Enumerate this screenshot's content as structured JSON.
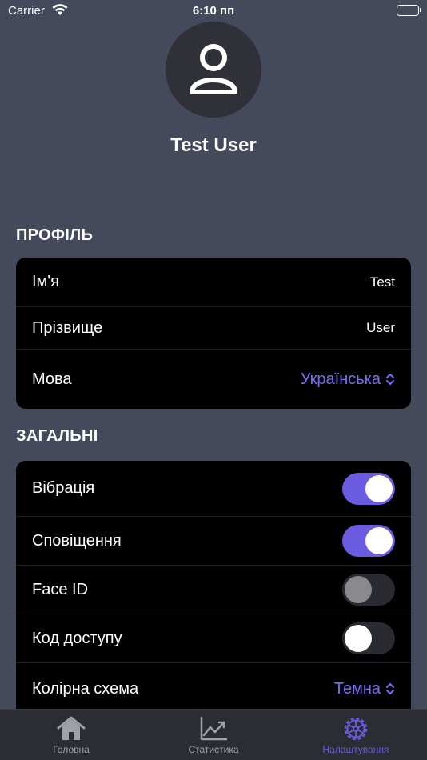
{
  "status_bar": {
    "carrier": "Carrier",
    "time": "6:10 пп"
  },
  "profile": {
    "username": "Test User"
  },
  "sections": {
    "profile_header": "ПРОФІЛЬ",
    "general_header": "ЗАГАЛЬНІ"
  },
  "profile_rows": {
    "first_name": {
      "label": "Ім'я",
      "value": "Test"
    },
    "last_name": {
      "label": "Прізвище",
      "value": "User"
    },
    "language": {
      "label": "Мова",
      "value": "Українська"
    }
  },
  "general_rows": {
    "vibration": {
      "label": "Вібрація",
      "on": true
    },
    "notifications": {
      "label": "Сповіщення",
      "on": true
    },
    "face_id": {
      "label": "Face ID",
      "on": false,
      "disabled": true
    },
    "passcode": {
      "label": "Код доступу",
      "on": false
    },
    "color_scheme": {
      "label": "Колірна схема",
      "value": "Темна"
    }
  },
  "tabs": [
    {
      "label": "Головна",
      "icon": "house-icon",
      "active": false
    },
    {
      "label": "Статистика",
      "icon": "chart-line-icon",
      "active": false
    },
    {
      "label": "Налаштування",
      "icon": "gear-icon",
      "active": true
    }
  ],
  "colors": {
    "accent": "#6a5be0",
    "background": "#444a5c",
    "card": "#000000"
  }
}
